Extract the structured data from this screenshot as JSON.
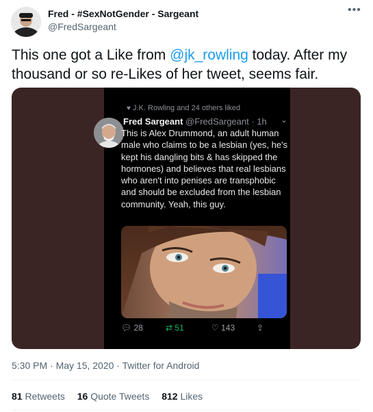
{
  "author": {
    "name": "Fred - #SexNotGender - Sargeant",
    "handle": "@FredSargeant"
  },
  "tweet": {
    "text_before": "This one got a Like from ",
    "mention": "@jk_rowling",
    "text_after": " today.  After my thousand or so re-Likes of her tweet, seems fair."
  },
  "embedded": {
    "liked_by": "J.K. Rowling and 24 others liked",
    "name": "Fred Sargeant",
    "handle_time": "@FredSargeant · 1h",
    "text": "This is Alex Drummond, an adult human male who claims to be a lesbian (yes, he's kept his dangling bits & has skipped the hormones) and believes that real lesbians who aren't into penises are transphobic and should be excluded from the lesbian community. Yeah, this guy.",
    "replies": "28",
    "retweets": "51",
    "likes": "143"
  },
  "meta": {
    "time": "5:30 PM · May 15, 2020 · Twitter for Android"
  },
  "stats": {
    "retweets_count": "81",
    "retweets_label": "Retweets",
    "quotes_count": "16",
    "quotes_label": "Quote Tweets",
    "likes_count": "812",
    "likes_label": "Likes"
  },
  "icons": {
    "more": "more-icon",
    "heart": "heart-icon",
    "reply": "reply-icon",
    "retweet": "retweet-icon",
    "share": "share-icon"
  },
  "colors": {
    "accent": "#1d9bf0",
    "retweet_green": "#17bf63",
    "media_bg": "#3b2524"
  }
}
